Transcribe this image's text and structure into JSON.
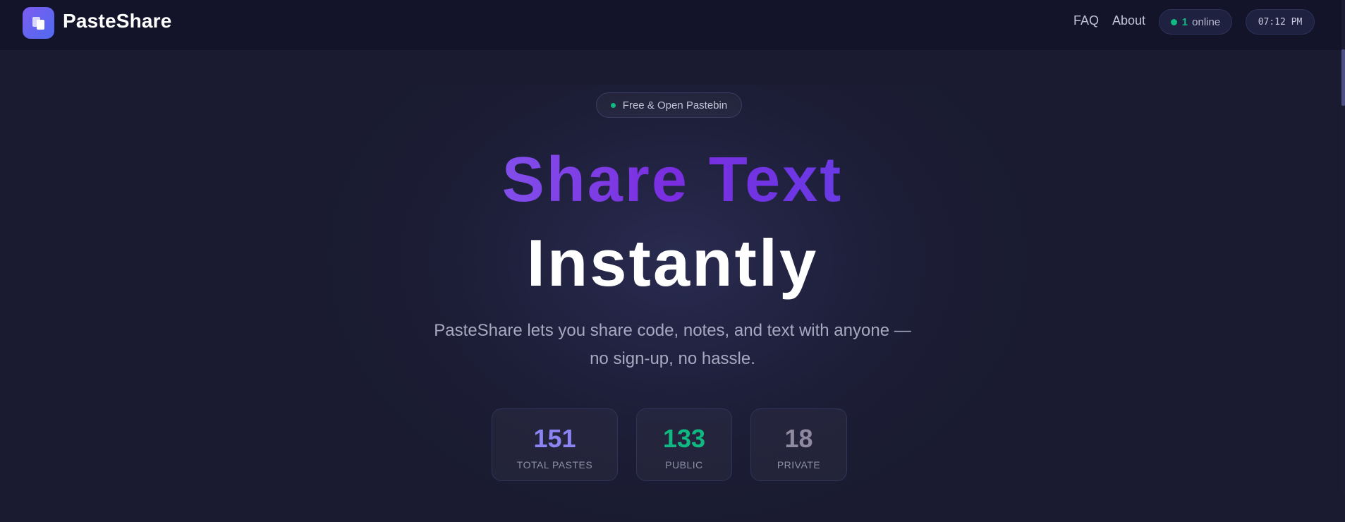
{
  "header": {
    "brand": "PasteShare",
    "nav": [
      {
        "label": "FAQ"
      },
      {
        "label": "About"
      }
    ],
    "online": {
      "count": "1",
      "label": "online"
    },
    "clock": "07:12 PM"
  },
  "hero": {
    "badge": "Free & Open Pastebin",
    "title_line1": "Share Text",
    "title_line2": "Instantly",
    "subtitle_line1": "PasteShare lets you share code, notes, and text with anyone —",
    "subtitle_line2": "no sign-up, no hassle."
  },
  "stats": [
    {
      "value": "151",
      "label": "TOTAL PASTES",
      "color": "#8b84f2"
    },
    {
      "value": "133",
      "label": "PUBLIC",
      "color": "#10b981"
    },
    {
      "value": "18",
      "label": "PRIVATE",
      "color": "#8f8aa0"
    }
  ],
  "colors": {
    "background": "#1a1b30",
    "accent": "#6d5cf0",
    "online": "#10b981"
  }
}
